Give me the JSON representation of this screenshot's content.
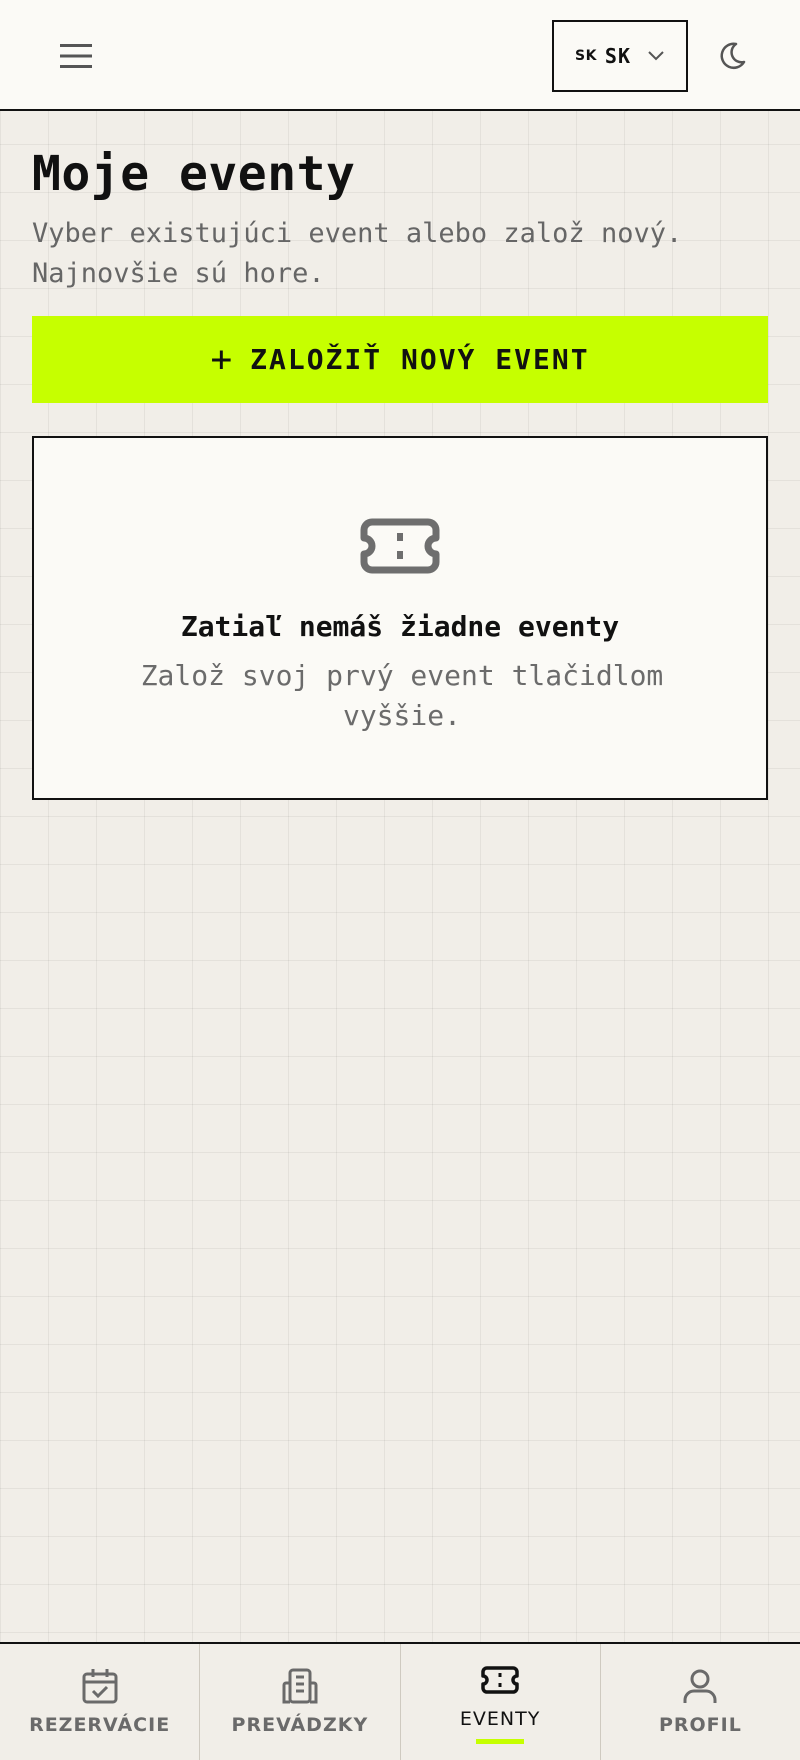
{
  "header": {
    "menu_icon": "hamburger-menu-icon",
    "language": {
      "flag": "SK",
      "code": "SK",
      "chevron_icon": "chevron-down-icon"
    },
    "theme_icon": "moon-icon"
  },
  "main": {
    "title": "Moje eventy",
    "subtitle": "Vyber existujúci event alebo založ nový. Najnovšie sú hore.",
    "create_button": {
      "icon": "plus",
      "plus_symbol": "+",
      "label": "ZALOŽIŤ NOVÝ EVENT"
    },
    "empty_state": {
      "icon": "ticket-icon",
      "title": "Zatiaľ nemáš žiadne eventy",
      "text": "Založ svoj prvý event tlačidlom vyššie."
    }
  },
  "bottom_nav": {
    "items": [
      {
        "label": "REZERVÁCIE",
        "icon": "calendar-check-icon",
        "active": false
      },
      {
        "label": "PREVÁDZKY",
        "icon": "building-icon",
        "active": false
      },
      {
        "label": "EVENTY",
        "icon": "ticket-icon",
        "active": true
      },
      {
        "label": "PROFIL",
        "icon": "user-icon",
        "active": false
      }
    ]
  },
  "colors": {
    "accent": "#c6ff00",
    "background": "#f1eee8",
    "surface": "#fbfaf6",
    "text": "#111111",
    "muted_text": "#666666"
  }
}
